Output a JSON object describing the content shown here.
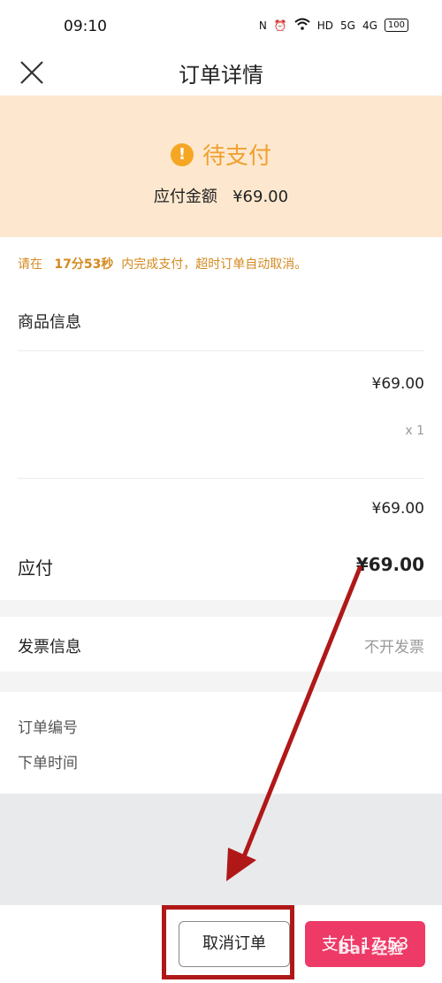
{
  "status_bar": {
    "time": "09:10",
    "icons": [
      "N",
      "⏰",
      "wifi",
      "HD",
      "5G",
      "4G",
      "100"
    ]
  },
  "nav": {
    "title": "订单详情",
    "close_icon": "close-icon"
  },
  "status": {
    "text": "待支付",
    "payable_label": "应付金额",
    "payable_amount": "¥69.00",
    "accent": "#f0a030"
  },
  "countdown": {
    "prefix": "请在",
    "time": "17分53秒",
    "suffix": "内完成支付，超时订单自动取消。"
  },
  "goods": {
    "section_title": "商品信息",
    "item_price": "¥69.00",
    "item_qty": "x 1",
    "subtotal": "¥69.00",
    "total_label": "应付",
    "total_value": "¥69.00"
  },
  "invoice": {
    "label": "发票信息",
    "value": "不开发票"
  },
  "order": {
    "number_label": "订单编号",
    "time_label": "下单时间"
  },
  "bottom": {
    "cancel_label": "取消订单",
    "pay_label": "支付 17:53",
    "pay_color": "#ee3a67",
    "highlight_color": "#b01818"
  },
  "watermark": "Bai 经验"
}
